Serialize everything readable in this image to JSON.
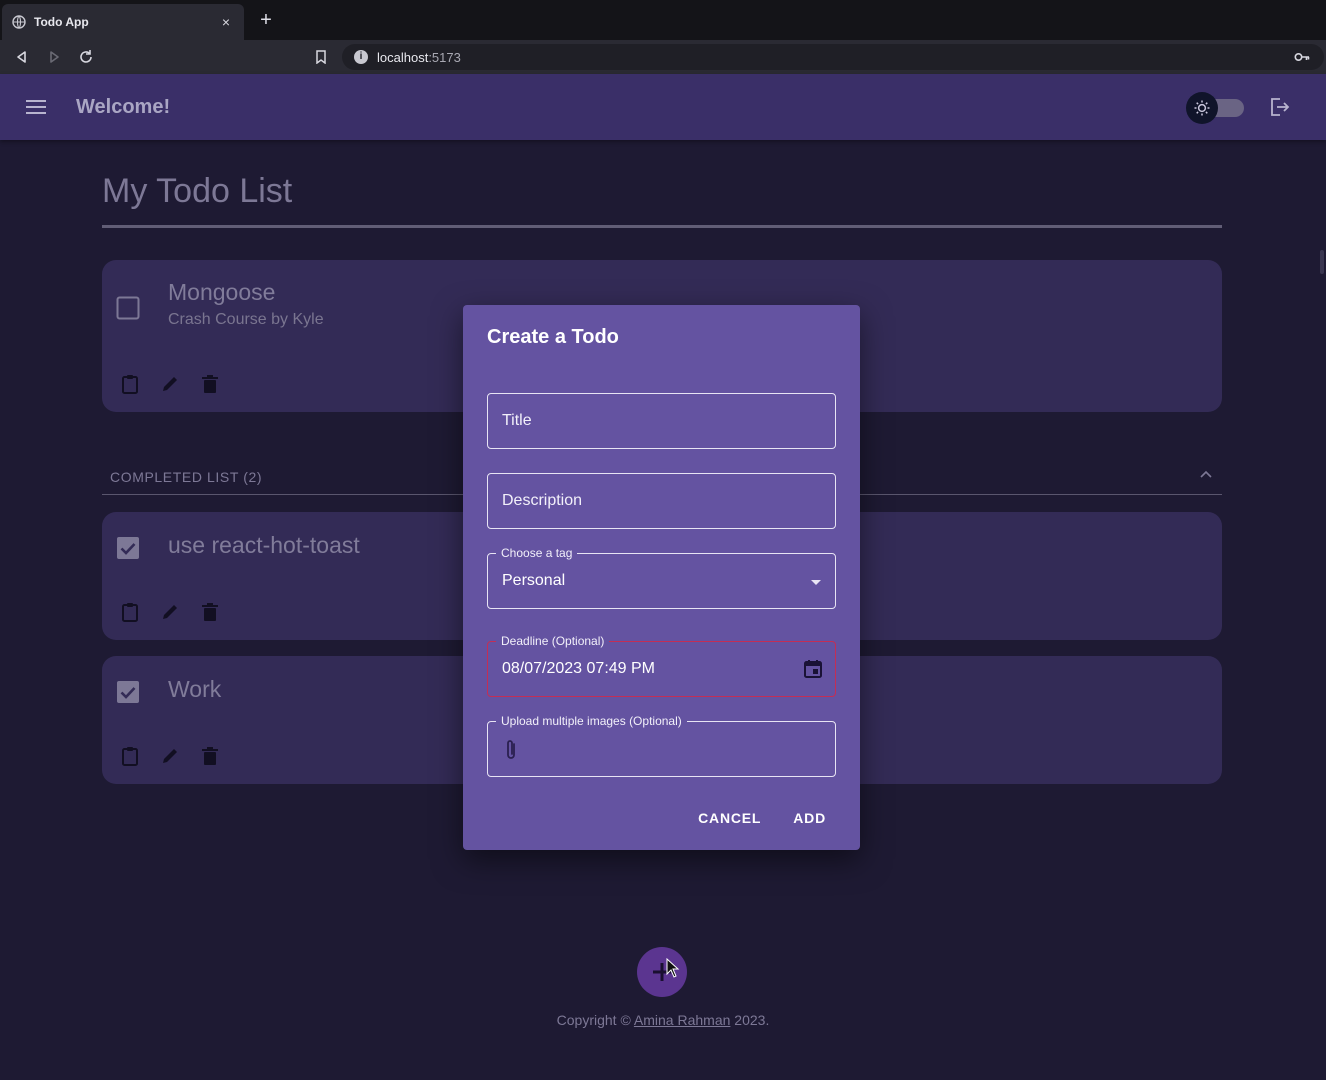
{
  "browser": {
    "tab_title": "Todo App",
    "tab_close": "×",
    "new_tab": "+",
    "url_host": "localhost",
    "url_port": ":5173",
    "url_info": "i"
  },
  "appbar": {
    "title": "Welcome!"
  },
  "main": {
    "page_title": "My Todo List",
    "active_todos": [
      {
        "title": "Mongoose",
        "description": "Crash Course by Kyle",
        "completed": false
      }
    ],
    "completed_header": "COMPLETED LIST (2)",
    "completed_todos": [
      {
        "title": "use react-hot-toast",
        "completed": true
      },
      {
        "title": "Work",
        "completed": true
      }
    ]
  },
  "dialog": {
    "title": "Create a Todo",
    "title_field_placeholder": "Title",
    "description_field_placeholder": "Description",
    "tag_label": "Choose a tag",
    "tag_value": "Personal",
    "deadline_label": "Deadline (Optional)",
    "deadline_value": "08/07/2023 07:49 PM",
    "upload_label": "Upload multiple images (Optional)",
    "cancel_label": "CANCEL",
    "add_label": "ADD"
  },
  "footer": {
    "prefix": "Copyright © ",
    "author": "Amina Rahman",
    "suffix": " 2023."
  },
  "colors": {
    "background": "#1e1a33",
    "appbar": "#3a2f68",
    "card": "#332b56",
    "dialog": "#6453a1",
    "fab": "#5b3590",
    "error_border": "#c42e55"
  }
}
